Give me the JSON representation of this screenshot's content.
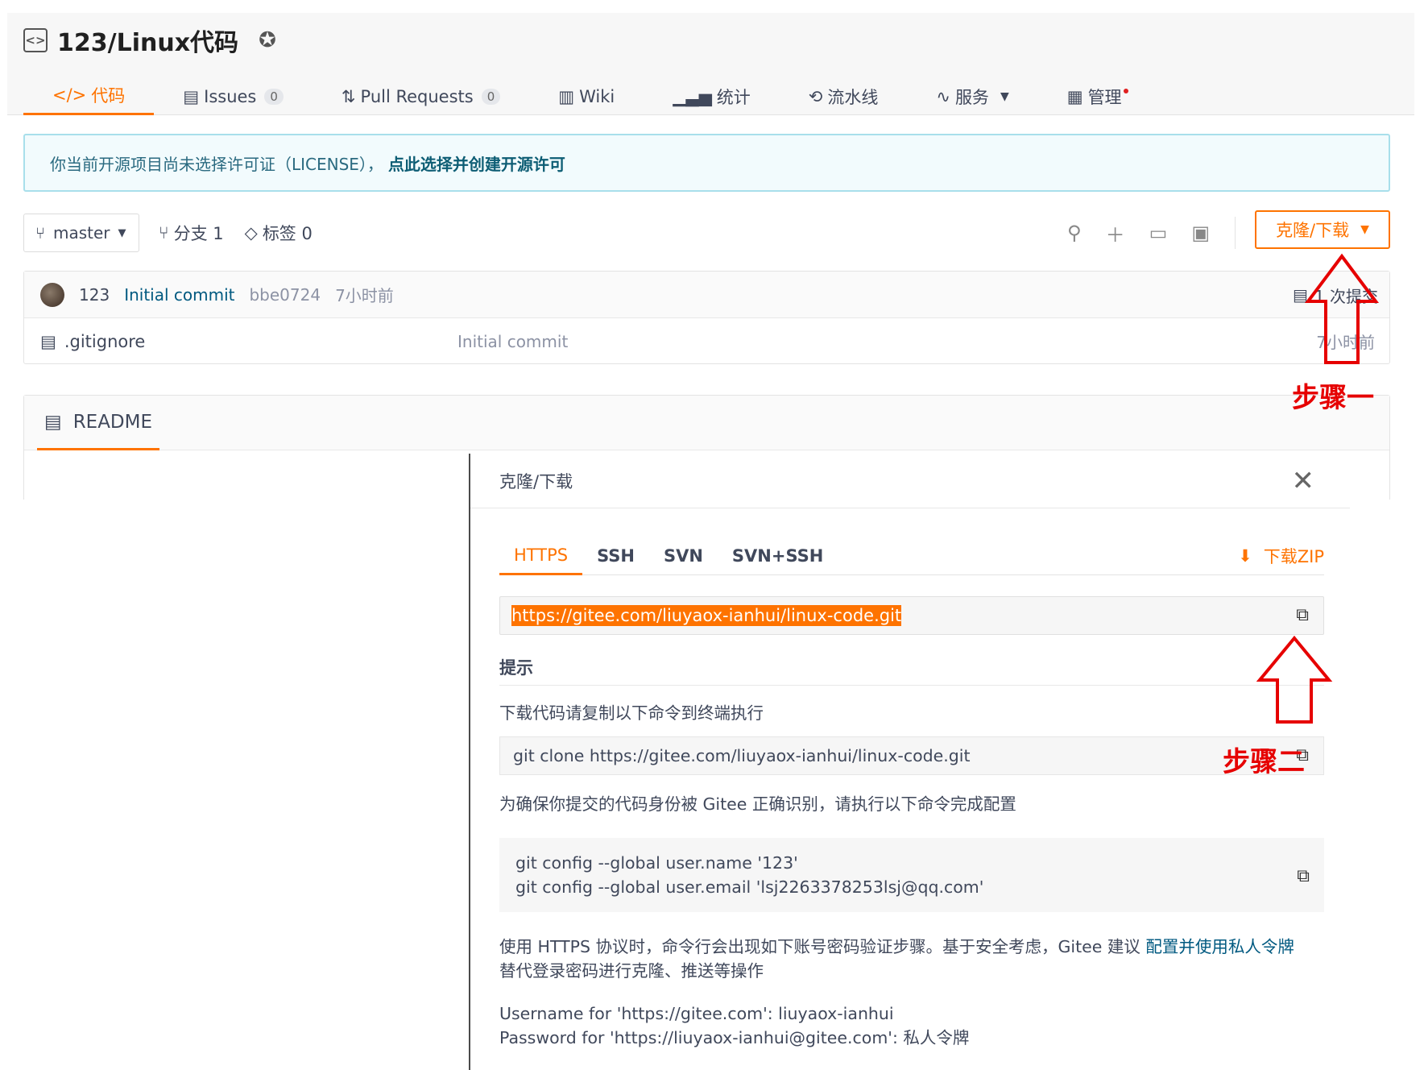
{
  "repo": {
    "title": "123/Linux代码"
  },
  "tabs": [
    {
      "label": "代码",
      "active": true
    },
    {
      "label": "Issues",
      "count": "0"
    },
    {
      "label": "Pull Requests",
      "count": "0"
    },
    {
      "label": "Wiki"
    },
    {
      "label": "统计"
    },
    {
      "label": "流水线"
    },
    {
      "label": "服务"
    },
    {
      "label": "管理"
    }
  ],
  "license": {
    "text": "你当前开源项目尚未选择许可证（LICENSE），",
    "link": "点此选择并创建开源许可"
  },
  "branch": {
    "name": "master",
    "branches": "分支 1",
    "tags": "标签 0"
  },
  "clone_button": "克隆/下载",
  "commit": {
    "author": "123",
    "message": "Initial commit",
    "sha": "bbe0724",
    "time": "7小时前",
    "commits": "1 次提交"
  },
  "files": [
    {
      "name": ".gitignore",
      "message": "Initial commit",
      "time": "7小时前"
    }
  ],
  "readme": {
    "label": "README"
  },
  "clone_panel": {
    "title": "克隆/下载",
    "protocols": [
      "HTTPS",
      "SSH",
      "SVN",
      "SVN+SSH"
    ],
    "download_zip": "下载ZIP",
    "url": "https://gitee.com/liuyaox-ianhui/linux-code.git",
    "hint_title": "提示",
    "hint_text": "下载代码请复制以下命令到终端执行",
    "clone_cmd": "git clone https://gitee.com/liuyaox-ianhui/linux-code.git",
    "config_text": "为确保你提交的代码身份被 Gitee 正确识别，请执行以下命令完成配置",
    "config_line1": "git config --global user.name '123'",
    "config_line2": "git config --global user.email 'lsj2263378253lsj@qq.com'",
    "https_text_1": "使用 HTTPS 协议时，命令行会出现如下账号密码验证步骤。基于安全考虑，Gitee 建议",
    "https_link": "配置并使用私人令牌",
    "https_text_2": "替代登录密码进行克隆、推送等操作",
    "username_line": "Username for 'https://gitee.com': liuyaox-ianhui",
    "password_line": "Password for 'https://liuyaox-ianhui@gitee.com': 私人令牌"
  },
  "annotations": {
    "step1": "步骤一",
    "step2": "步骤二",
    "color": "#e60000"
  },
  "colors": {
    "accent": "#fe7300",
    "link": "#005980"
  }
}
